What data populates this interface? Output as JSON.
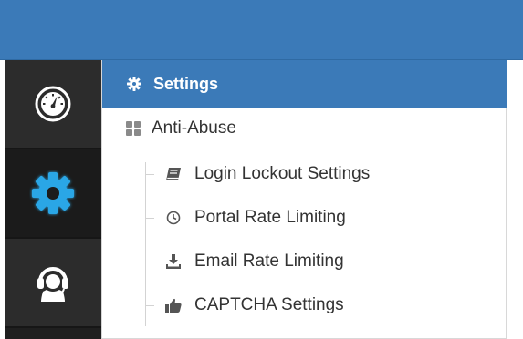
{
  "rail": {
    "items": [
      {
        "name": "dashboard-icon",
        "active": false
      },
      {
        "name": "gear-icon",
        "active": true
      },
      {
        "name": "support-headset-icon",
        "active": false
      }
    ]
  },
  "menu": {
    "header": {
      "label": "Settings",
      "icon": "gear-icon"
    },
    "group": {
      "label": "Anti-Abuse",
      "icon": "grid-icon"
    },
    "items": [
      {
        "label": "Login Lockout Settings",
        "icon": "book-icon"
      },
      {
        "label": "Portal Rate Limiting",
        "icon": "clock-icon"
      },
      {
        "label": "Email Rate Limiting",
        "icon": "download-icon"
      },
      {
        "label": "CAPTCHA Settings",
        "icon": "thumbs-up-icon"
      }
    ]
  },
  "colors": {
    "brand_blue": "#3b7ab8",
    "active_gear_blue": "#2aa6e6",
    "rail_bg": "#2c2c2c",
    "text": "#333333"
  }
}
